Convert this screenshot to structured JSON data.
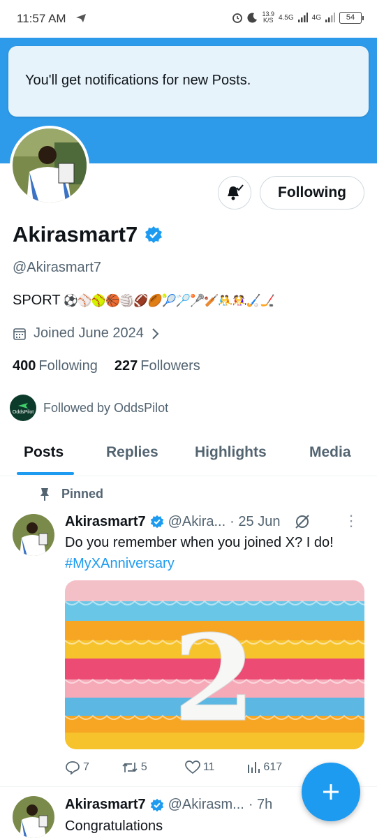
{
  "status_bar": {
    "time": "11:57 AM",
    "speed_value": "13.9",
    "speed_unit": "K/S",
    "network_1": "4.5G",
    "network_2": "4G",
    "battery": "54"
  },
  "toast": {
    "message": "You'll get notifications for new Posts."
  },
  "profile": {
    "display_name": "Akirasmart7",
    "handle": "@Akirasmart7",
    "bio_text": "SPORT",
    "bio_emojis": "⚽⚾🥎🏀🏐🏈🏉🎾🏸🥍🏏🤼🤼‍♀️🏑🏒",
    "joined": "Joined June 2024",
    "following_count": "400",
    "following_label": "Following",
    "followers_count": "227",
    "followers_label": "Followers",
    "followed_by": "Followed by OddsPilot",
    "followed_by_logo": "OddsPilot"
  },
  "buttons": {
    "following": "Following"
  },
  "tabs": [
    "Posts",
    "Replies",
    "Highlights",
    "Media"
  ],
  "tweets": [
    {
      "pinned_label": "Pinned",
      "name": "Akirasmart7",
      "handle": "@Akira...",
      "time": "· 25 Jun",
      "text": "Do you remember when you joined X? I do! ",
      "hashtag": "#MyXAnniversary",
      "media_numeral": "2",
      "replies": "7",
      "reposts": "5",
      "likes": "11",
      "views": "617"
    },
    {
      "name": "Akirasmart7",
      "handle": "@Akirasm...",
      "time": "· 7h",
      "text": "Congratulations"
    }
  ],
  "colors": {
    "accent": "#1d9bf0",
    "banner": "#2e9bea",
    "muted": "#536471"
  }
}
